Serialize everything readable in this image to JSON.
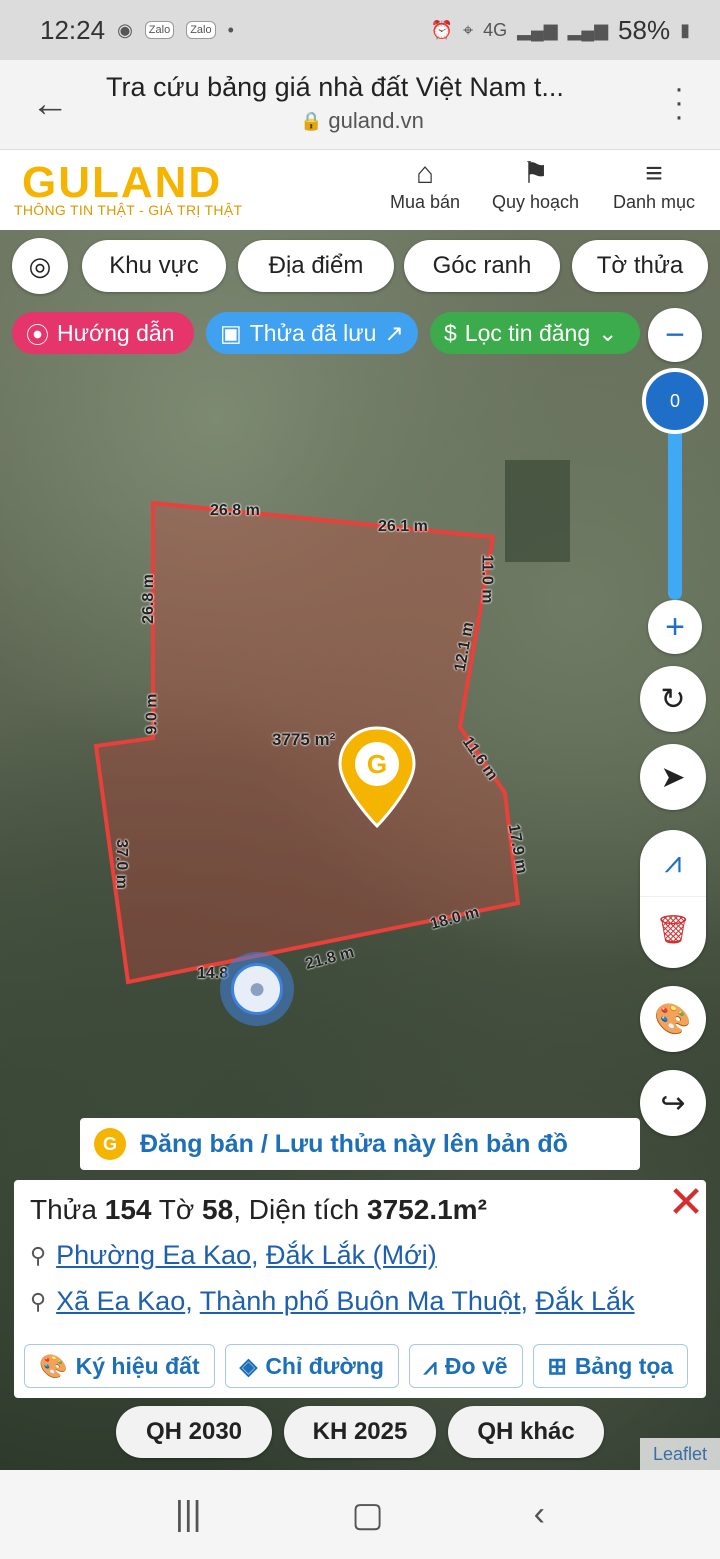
{
  "status_bar": {
    "time": "12:24",
    "battery": "58%",
    "network": "4G"
  },
  "browser": {
    "title": "Tra cứu bảng giá nhà đất Việt Nam t...",
    "url": "guland.vn"
  },
  "site": {
    "logo": "GULAND",
    "tagline": "THÔNG TIN THẬT - GIÁ TRỊ THẬT",
    "nav": [
      {
        "label": "Mua bán",
        "icon": "house-icon"
      },
      {
        "label": "Quy hoạch",
        "icon": "map-search-icon"
      },
      {
        "label": "Danh mục",
        "icon": "menu-icon"
      }
    ]
  },
  "map_controls": {
    "chips": [
      "Khu vực",
      "Địa điểm",
      "Góc ranh",
      "Tờ thửa"
    ],
    "guide": "Hướng dẫn",
    "saved": "Thửa đã lưu",
    "filter": "Lọc tin đăng",
    "zoom_value": "0"
  },
  "parcel": {
    "area_label": "3775 m²",
    "dims": [
      "26.8 m",
      "26.1 m",
      "11.0 m",
      "26.8 m",
      "12.1 m",
      "9.0 m",
      "11.6 m",
      "37.0 m",
      "17.9 m",
      "18.0 m",
      "21.8 m",
      "14.8"
    ]
  },
  "post_banner": "Đăng bán / Lưu thửa này lên bản đồ",
  "info": {
    "thua_label": "Thửa",
    "thua": "154",
    "to_label": "Tờ",
    "to": "58",
    "dien_tich_label": ", Diện tích",
    "dien_tich": "3752.1m²",
    "addr1_a": "Phường Ea Kao",
    "addr1_b": "Đắk Lắk (Mới)",
    "addr2_a": "Xã Ea Kao",
    "addr2_b": "Thành phố Buôn Ma Thuột",
    "addr2_c": "Đắk Lắk",
    "tools": [
      "Ký hiệu đất",
      "Chỉ đường",
      "Đo vẽ",
      "Bảng tọa"
    ]
  },
  "plans": [
    "QH 2030",
    "KH 2025",
    "QH khác"
  ],
  "attribution": "Leaflet",
  "colors": {
    "brand": "#f5b400",
    "parcel": "#e8403a",
    "link": "#1d5fb0"
  }
}
